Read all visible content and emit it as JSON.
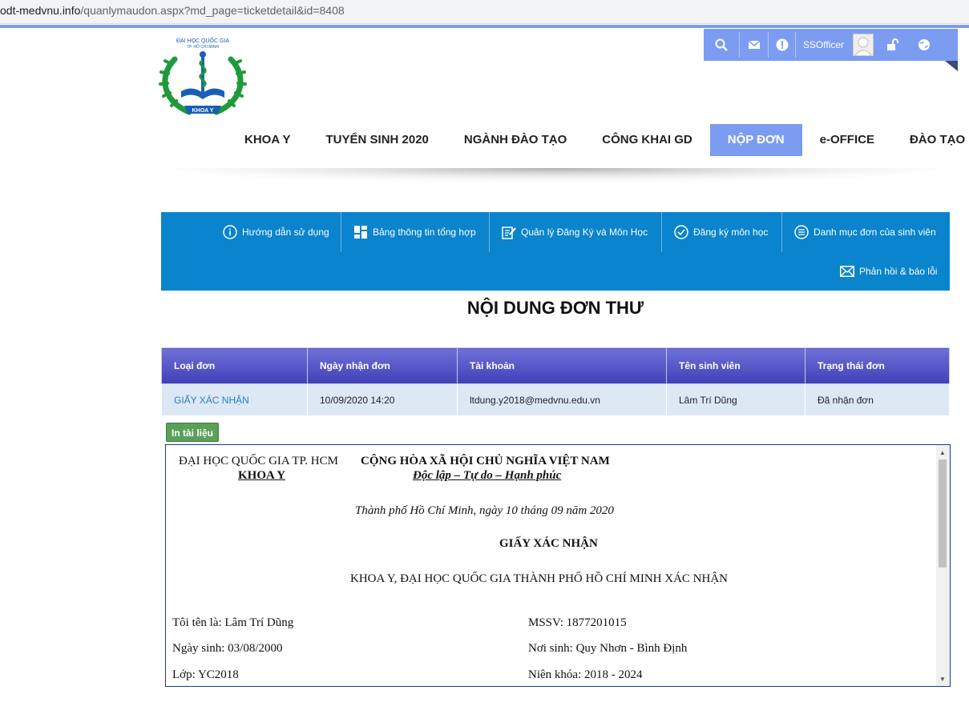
{
  "browser": {
    "url_host": "odt-medvnu.info",
    "url_path": "/quanlymaudon.aspx?md_page=ticketdetail&id=8408"
  },
  "logo": {
    "top_text": "ĐẠI HỌC QUỐC GIA",
    "sub_text": "TP. HỒ CHÍ MINH",
    "ribbon_text": "KHOA Y",
    "accent_green": "#1f9a3a",
    "accent_blue": "#1a5fb4"
  },
  "toolbar": {
    "user": "SSOfficer",
    "icons": [
      "search-icon",
      "mail-icon",
      "alert-icon",
      "user-avatar",
      "unlock-icon",
      "globe-icon"
    ]
  },
  "main_nav": [
    {
      "label": "KHOA Y",
      "active": false
    },
    {
      "label": "TUYỂN SINH 2020",
      "active": false
    },
    {
      "label": "NGÀNH ĐÀO TẠO",
      "active": false
    },
    {
      "label": "CÔNG KHAI GD",
      "active": false
    },
    {
      "label": "NỘP ĐƠN",
      "active": true
    },
    {
      "label": "e-OFFICE",
      "active": false
    },
    {
      "label": "ĐÀO TẠO",
      "active": false
    }
  ],
  "blue_menu": [
    {
      "label": "Hướng dẫn sử dụng",
      "icon": "info-icon"
    },
    {
      "label": "Bảng thông tin tổng hợp",
      "icon": "dashboard-icon"
    },
    {
      "label": "Quản lý Đăng Ký và Môn Học",
      "icon": "edit-icon"
    },
    {
      "label": "Đăng ký môn học",
      "icon": "check-circle-icon"
    },
    {
      "label": "Danh mục đơn của sinh viên",
      "icon": "list-icon"
    },
    {
      "label": "Phản hồi & báo lỗi",
      "icon": "envelope-icon"
    }
  ],
  "page_title": "NỘI DUNG ĐƠN THƯ",
  "table": {
    "headers": [
      "Loại đơn",
      "Ngày nhận đơn",
      "Tài khoản",
      "Tên sinh viên",
      "Trạng thái đơn"
    ],
    "row": [
      "GIẤY XÁC NHẬN",
      "10/09/2020 14:20",
      "ltdung.y2018@medvnu.edu.vn",
      "Lâm Trí Dũng",
      "Đã nhận đơn"
    ]
  },
  "print_button": "In tài liệu",
  "document": {
    "org_line1": "ĐẠI HỌC QUỐC GIA TP. HCM",
    "org_line2": "KHOA Y",
    "nation_line1": "CỘNG HÒA XÃ HỘI CHỦ NGHĨA VIỆT NAM",
    "nation_line2": "Độc lập – Tự do – Hạnh phúc",
    "date_line": "Thành phố Hồ Chí Minh, ngày 10 tháng 09 năm 2020",
    "title": "GIẤY XÁC NHẬN",
    "subtitle": "KHOA Y, ĐẠI HỌC QUỐC GIA THÀNH PHỐ HỒ CHÍ MINH XÁC NHẬN",
    "name": "Tôi tên là: Lâm Trí Dũng",
    "student_id": "MSSV: 1877201015",
    "dob": "Ngày sinh: 03/08/2000",
    "birthplace": "Nơi sinh: Quy Nhơn - Bình Định",
    "class": "Lớp: YC2018",
    "cohort": "Niên khóa: 2018 - 2024"
  }
}
